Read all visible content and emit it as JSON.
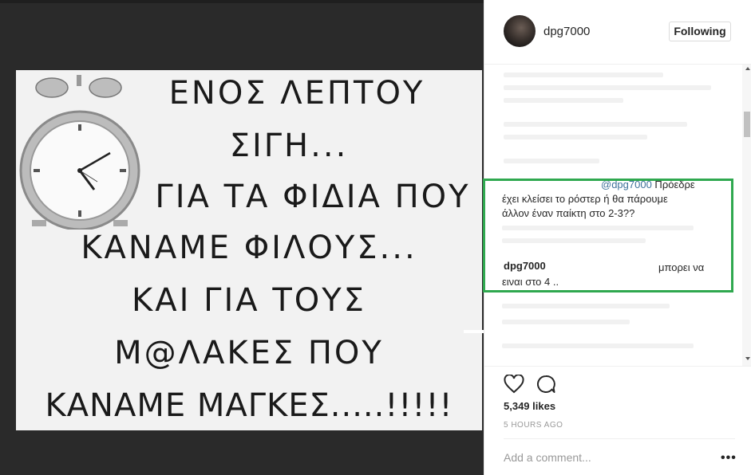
{
  "post": {
    "meme_lines": [
      "ΕΝΟΣ ΛΕΠΤΟΥ",
      "ΣΙΓΗ...",
      "ΓΙΑ ΤΑ ΦΙΔΙΑ ΠΟΥ",
      "ΚΑΝΑΜΕ  ΦΙΛΟΥΣ...",
      "ΚΑΙ ΓΙΑ ΤΟΥΣ",
      "Μ@ΛΑΚΕΣ ΠΟΥ",
      "ΚΑΝΑΜΕ ΜΑΓΚΕΣ.....!!!!!"
    ]
  },
  "header": {
    "username": "dpg7000",
    "follow_label": "Following"
  },
  "comments": {
    "question": {
      "mention": "@dpg7000",
      "line1_rest": " Πρόεδρε",
      "line2": "έχει κλείσει το ρόστερ ή θα πάρουμε",
      "line3": "άλλον έναν παίκτη στο 2-3??"
    },
    "reply": {
      "author": "dpg7000",
      "line1": "μπορει να",
      "line2": "ειναι στο 4 .."
    }
  },
  "actions": {
    "likes": "5,349 likes",
    "time": "5 HOURS AGO",
    "add_comment_placeholder": "Add a comment...",
    "more_label": "•••"
  },
  "colors": {
    "highlight": "#2fa84f",
    "mention": "#3f729b"
  }
}
